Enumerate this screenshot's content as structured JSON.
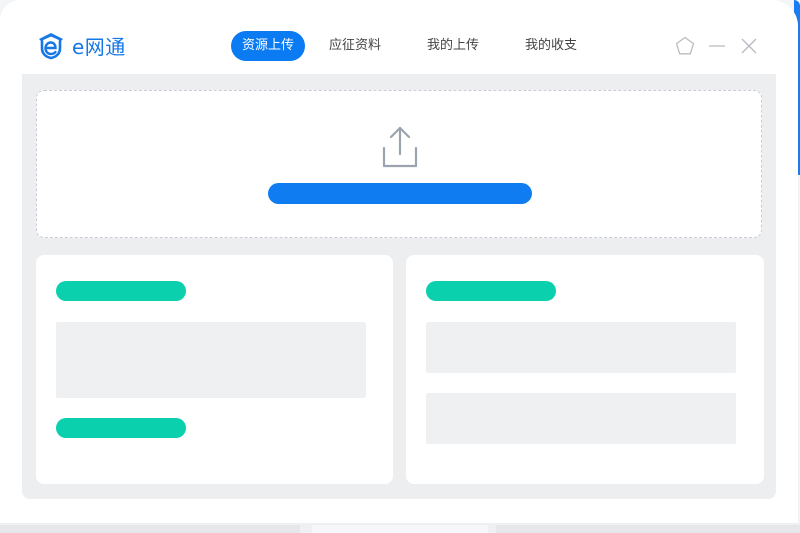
{
  "app": {
    "logo_text": "e网通",
    "brand_color": "#1677e6",
    "accent_color": "#0a7bf3",
    "highlight_color": "#0bd0ae"
  },
  "tabs": [
    {
      "label": "资源上传",
      "active": true
    },
    {
      "label": "应征资料",
      "active": false
    },
    {
      "label": "我的上传",
      "active": false
    },
    {
      "label": "我的收支",
      "active": false
    }
  ],
  "window_controls": {
    "icons": [
      "pentagon-icon",
      "minimize-icon",
      "close-icon"
    ]
  },
  "upload": {
    "icon": "upload-icon"
  }
}
